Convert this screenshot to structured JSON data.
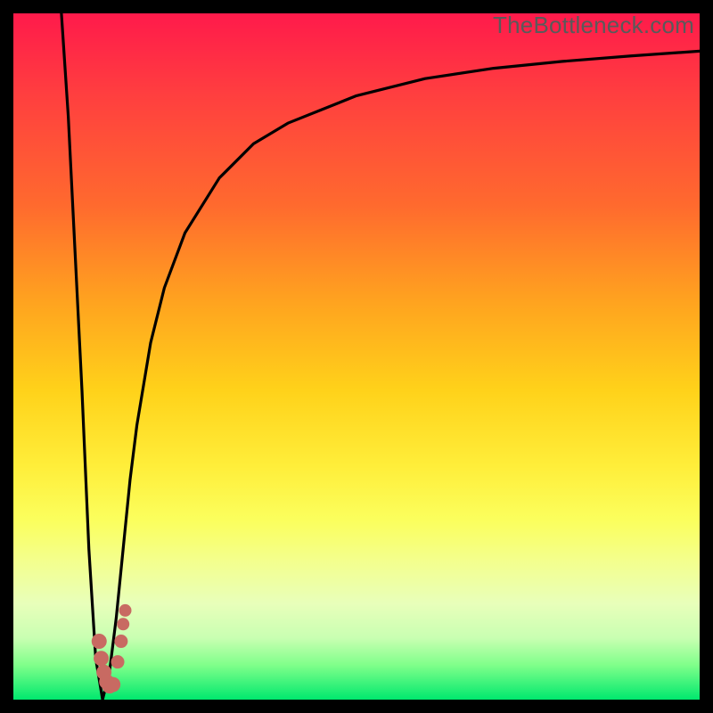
{
  "watermark": "TheBottleneck.com",
  "chart_data": {
    "type": "line",
    "title": "",
    "xlabel": "",
    "ylabel": "",
    "xlim": [
      0,
      100
    ],
    "ylim": [
      0,
      100
    ],
    "grid": false,
    "series": [
      {
        "name": "bottleneck-curve",
        "x": [
          7,
          8,
          9,
          10,
          11,
          12,
          13,
          14,
          15,
          16,
          17,
          18,
          20,
          22,
          25,
          30,
          35,
          40,
          50,
          60,
          70,
          80,
          90,
          100
        ],
        "y": [
          100,
          85,
          65,
          45,
          22,
          6,
          0,
          4,
          12,
          22,
          32,
          40,
          52,
          60,
          68,
          76,
          81,
          84,
          88,
          90.5,
          92,
          93,
          93.8,
          94.5
        ]
      },
      {
        "name": "highlight-dots",
        "x": [
          12.5,
          12.8,
          13.2,
          13.6,
          14.0,
          14.5,
          15.2,
          15.7,
          16.0,
          16.3
        ],
        "y": [
          8.5,
          6.0,
          4.0,
          2.6,
          2.0,
          2.2,
          5.5,
          8.5,
          11.0,
          13.0
        ]
      }
    ],
    "colors": {
      "curve": "#000000",
      "dots": "#c86a62",
      "gradient_top": "#ff1a4b",
      "gradient_bottom": "#00e86e"
    }
  }
}
